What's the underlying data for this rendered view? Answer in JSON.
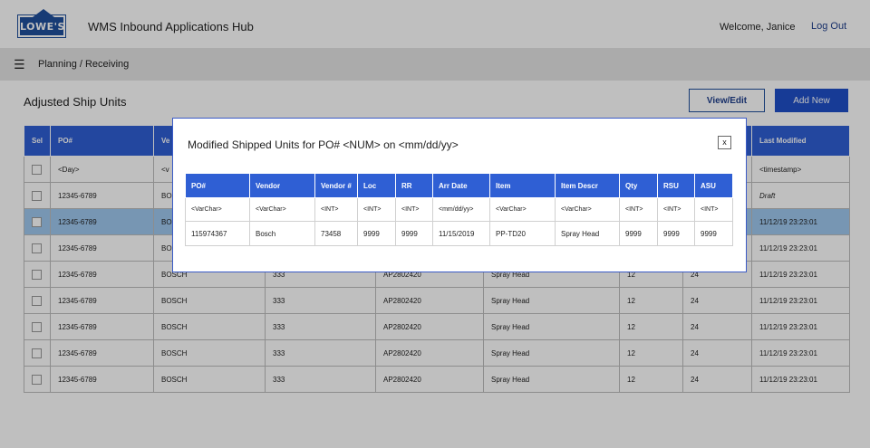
{
  "header": {
    "logo_text": "LOWE'S",
    "app_title": "WMS Inbound Applications Hub",
    "welcome": "Welcome, Janice",
    "logout": "Log Out"
  },
  "subbar": {
    "breadcrumb": "Planning / Receiving"
  },
  "page": {
    "title": "Adjusted Ship Units",
    "view_edit": "View/Edit",
    "add_new": "Add New"
  },
  "table": {
    "headers": [
      "Sel",
      "PO#",
      "Ve",
      "",
      "",
      "",
      "",
      "",
      "Last Modified"
    ],
    "filter_row": [
      "<Day>",
      "<v",
      "<timestamp>"
    ],
    "rows": [
      {
        "po": "12345-6789",
        "vendor": "BOS",
        "vnum": "",
        "item_id": "",
        "descr": "",
        "qty": "",
        "rsu": "",
        "modified": "Draft",
        "draft": true,
        "hl": false
      },
      {
        "po": "12345-6789",
        "vendor": "BOS",
        "vnum": "",
        "item_id": "",
        "descr": "",
        "qty": "",
        "rsu": "",
        "modified": "11/12/19  23:23:01",
        "draft": false,
        "hl": true
      },
      {
        "po": "12345-6789",
        "vendor": "BOS",
        "vnum": "",
        "item_id": "",
        "descr": "",
        "qty": "",
        "rsu": "",
        "modified": "11/12/19  23:23:01",
        "draft": false,
        "hl": false
      },
      {
        "po": "12345-6789",
        "vendor": "BOSCH",
        "vnum": "333",
        "item_id": "AP2802420",
        "descr": "Spray Head",
        "qty": "12",
        "rsu": "24",
        "modified": "11/12/19  23:23:01",
        "draft": false,
        "hl": false
      },
      {
        "po": "12345-6789",
        "vendor": "BOSCH",
        "vnum": "333",
        "item_id": "AP2802420",
        "descr": "Spray Head",
        "qty": "12",
        "rsu": "24",
        "modified": "11/12/19  23:23:01",
        "draft": false,
        "hl": false
      },
      {
        "po": "12345-6789",
        "vendor": "BOSCH",
        "vnum": "333",
        "item_id": "AP2802420",
        "descr": "Spray Head",
        "qty": "12",
        "rsu": "24",
        "modified": "11/12/19  23:23:01",
        "draft": false,
        "hl": false
      },
      {
        "po": "12345-6789",
        "vendor": "BOSCH",
        "vnum": "333",
        "item_id": "AP2802420",
        "descr": "Spray Head",
        "qty": "12",
        "rsu": "24",
        "modified": "11/12/19  23:23:01",
        "draft": false,
        "hl": false
      },
      {
        "po": "12345-6789",
        "vendor": "BOSCH",
        "vnum": "333",
        "item_id": "AP2802420",
        "descr": "Spray Head",
        "qty": "12",
        "rsu": "24",
        "modified": "11/12/19  23:23:01",
        "draft": false,
        "hl": false
      }
    ]
  },
  "modal": {
    "title": "Modified Shipped Units for PO# <NUM> on <mm/dd/yy>",
    "close": "x",
    "headers": [
      "PO#",
      "Vendor",
      "Vendor #",
      "Loc",
      "RR",
      "Arr Date",
      "Item",
      "Item Descr",
      "Qty",
      "RSU",
      "ASU"
    ],
    "types": [
      "<VarChar>",
      "<VarChar>",
      "<INT>",
      "<INT>",
      "<INT>",
      "<mm/dd/yy>",
      "<VarChar>",
      "<VarChar>",
      "<INT>",
      "<INT>",
      "<INT>"
    ],
    "values": [
      "115974367",
      "Bosch",
      "73458",
      "9999",
      "9999",
      "11/15/2019",
      "PP-TD20",
      "Spray Head",
      "9999",
      "9999",
      "9999"
    ]
  }
}
